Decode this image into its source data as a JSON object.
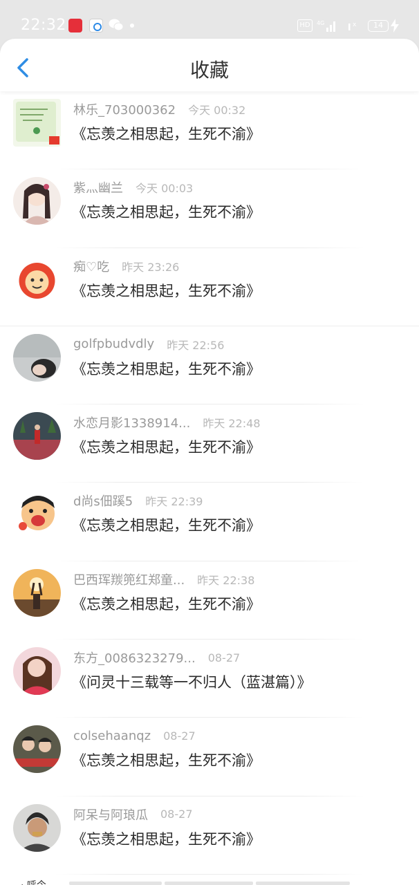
{
  "status_bar": {
    "time": "22:32",
    "battery": "14",
    "hd_label": "HD",
    "network_label": "4G"
  },
  "header": {
    "title": "收藏"
  },
  "items": [
    {
      "user": "林乐_703000362",
      "time": "今天 00:32",
      "title": "《忘羡之相思起，生死不渝》",
      "avatar": "avatar-green-note"
    },
    {
      "user": "紫灬幽兰",
      "time": "今天 00:03",
      "title": "《忘羡之相思起，生死不渝》",
      "avatar": "avatar-anime-girl"
    },
    {
      "user": "痴♡吃",
      "time": "昨天 23:26",
      "title": "《忘羡之相思起，生死不渝》",
      "avatar": "avatar-lion-cartoon"
    },
    {
      "user": "golfpbudvdly",
      "time": "昨天 22:56",
      "title": "《忘羡之相思起，生死不渝》",
      "avatar": "avatar-grey-photo"
    },
    {
      "user": "水恋月影1338914...",
      "time": "昨天 22:48",
      "title": "《忘羡之相思起，生死不渝》",
      "avatar": "avatar-park-photo"
    },
    {
      "user": "d尚s佃蹊5",
      "time": "昨天 22:39",
      "title": "《忘羡之相思起，生死不渝》",
      "avatar": "avatar-cartoon-boy"
    },
    {
      "user": "巴西珲羰篼红郑童...",
      "time": "昨天 22:38",
      "title": "《忘羡之相思起，生死不渝》",
      "avatar": "avatar-sunset-photo"
    },
    {
      "user": "东方_0086323279...",
      "time": "08-27",
      "title": "《问灵十三载等一不归人（蓝湛篇）》",
      "avatar": "avatar-woman-photo"
    },
    {
      "user": "colsehaanqz",
      "time": "08-27",
      "title": "《忘羡之相思起，生死不渝》",
      "avatar": "avatar-kids-photo"
    },
    {
      "user": "阿呆与阿琅瓜",
      "time": "08-27",
      "title": "《忘羡之相思起，生死不渝》",
      "avatar": "avatar-boy-photo"
    }
  ],
  "bottom_peek": {
    "label": "· 呼今"
  }
}
